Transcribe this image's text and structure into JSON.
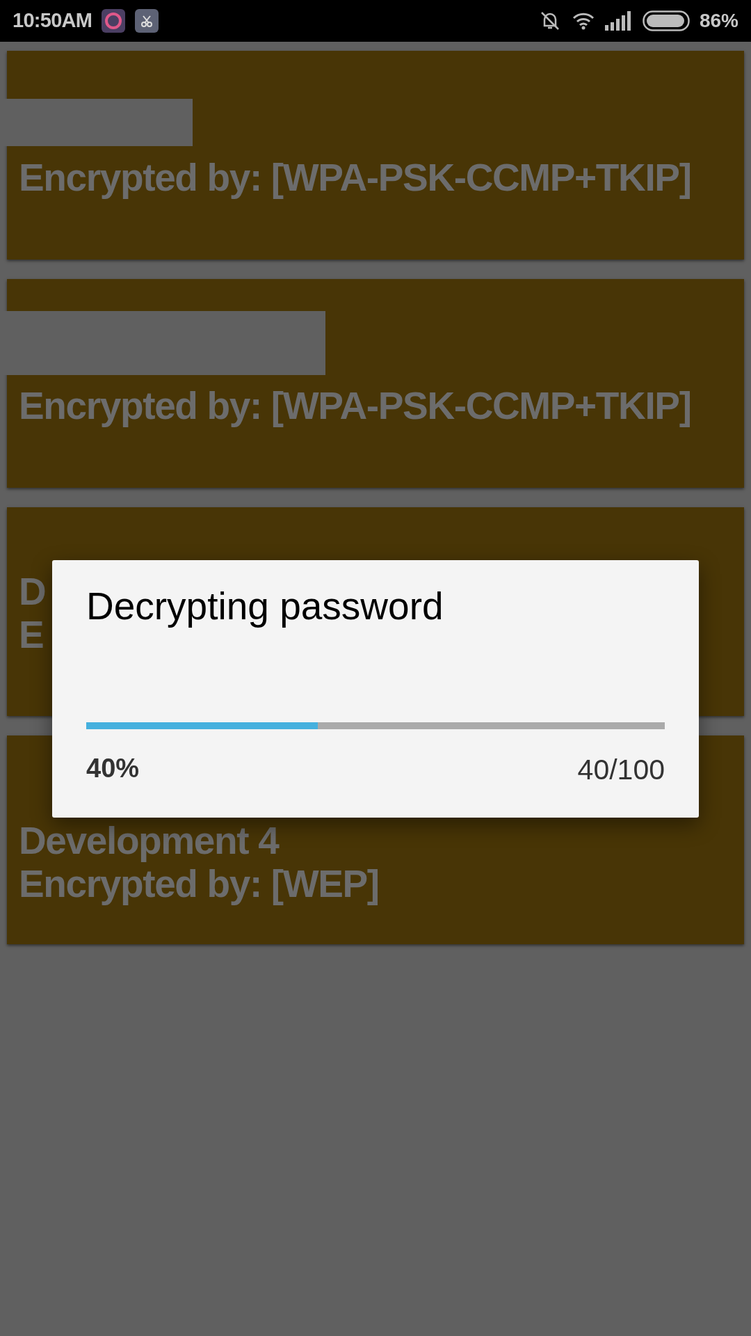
{
  "status_bar": {
    "time": "10:50AM",
    "battery_text": "86%"
  },
  "networks": [
    {
      "title_redacted": true,
      "lines": [
        "Encrypted by: [WPA-PSK-CCMP+TKIP]"
      ]
    },
    {
      "title_redacted": true,
      "lines": [
        "Encrypted by: [WPA-PSK-CCMP+TKIP]"
      ]
    },
    {
      "title_redacted": false,
      "lines": [
        "D",
        "E"
      ]
    },
    {
      "title_redacted": false,
      "lines": [
        "Development 4",
        "Encrypted by: [WEP]"
      ]
    }
  ],
  "dialog": {
    "title": "Decrypting password",
    "progress": {
      "level": 0.4
    },
    "percent": "40%",
    "count": "40/100"
  }
}
